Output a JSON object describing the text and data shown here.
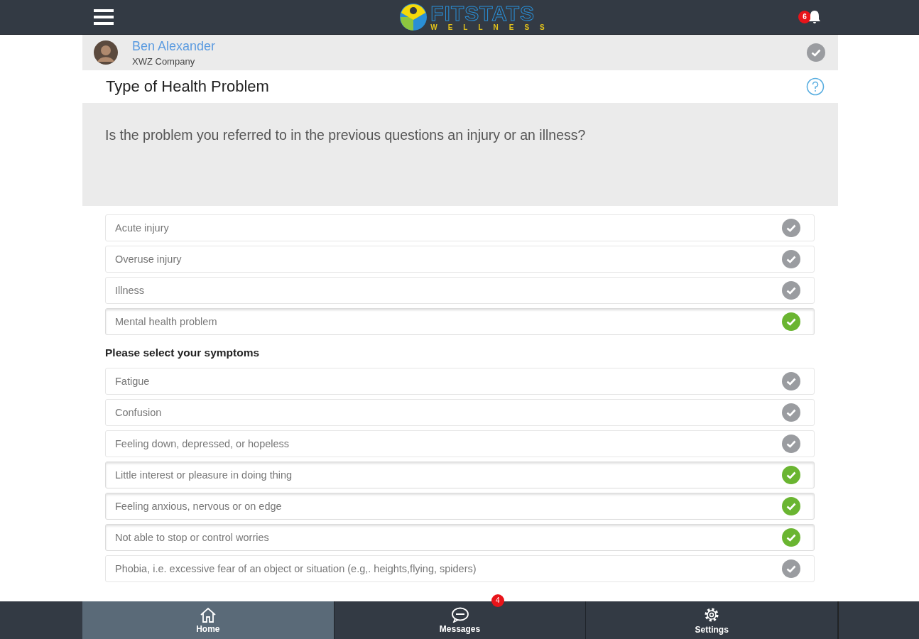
{
  "header": {
    "logo": {
      "name": "FITSTATS",
      "tagline": "WELLNESS"
    },
    "notifications": "6"
  },
  "user": {
    "name": "Ben Alexander",
    "company": "XWZ Company",
    "checked": false
  },
  "page_title": "Type of Health Problem",
  "question": "Is the problem you referred to in the previous questions an injury or an illness?",
  "problem_options": [
    {
      "label": "Acute injury",
      "checked": false
    },
    {
      "label": "Overuse injury",
      "checked": false
    },
    {
      "label": "Illness",
      "checked": false
    },
    {
      "label": "Mental health problem",
      "checked": true
    }
  ],
  "symptoms_heading": "Please select your symptoms",
  "symptom_options": [
    {
      "label": "Fatigue",
      "checked": false
    },
    {
      "label": "Confusion",
      "checked": false
    },
    {
      "label": "Feeling down, depressed, or hopeless",
      "checked": false
    },
    {
      "label": "Little interest or pleasure in doing thing",
      "checked": true
    },
    {
      "label": "Feeling anxious, nervous or on edge",
      "checked": true
    },
    {
      "label": "Not able to stop or control worries",
      "checked": true
    },
    {
      "label": "Phobia, i.e. excessive fear of an object or situation (e.g,. heights,flying, spiders)",
      "checked": false
    }
  ],
  "bottom_nav": [
    {
      "label": "Home",
      "kind": "home",
      "selected": true
    },
    {
      "label": "Messages",
      "kind": "messages",
      "selected": false,
      "badge": "4"
    },
    {
      "label": "Settings",
      "kind": "settings",
      "selected": false
    }
  ]
}
